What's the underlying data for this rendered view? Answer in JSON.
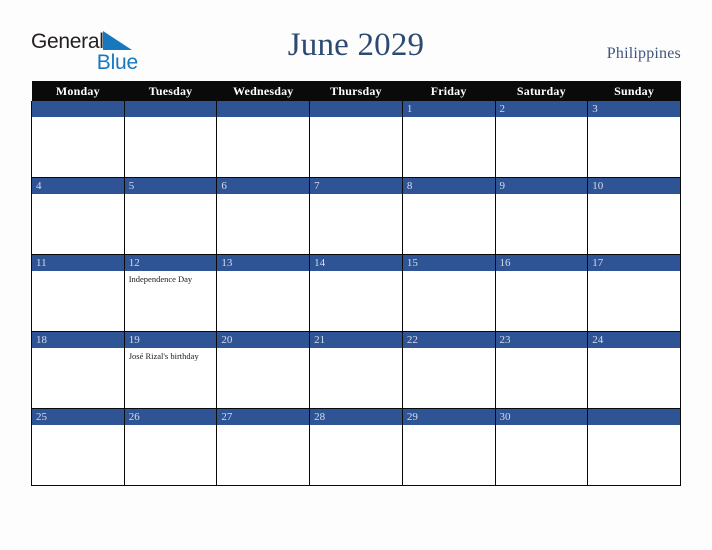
{
  "brand": {
    "name_part1": "General",
    "name_part2": "Blue",
    "triangle_icon": "blue-triangle-icon",
    "color_dark": "#231f20",
    "color_blue": "#1878be"
  },
  "header": {
    "title": "June 2029",
    "country": "Philippines",
    "title_color": "#2e4a72"
  },
  "calendar": {
    "month": "June",
    "year": "2029",
    "weekday_headers": [
      "Monday",
      "Tuesday",
      "Wednesday",
      "Thursday",
      "Friday",
      "Saturday",
      "Sunday"
    ],
    "header_bg": "#0a0a0a",
    "daybar_bg": "#2e5496",
    "daybar_text": "#d6dce8",
    "weeks": [
      [
        {
          "day": ""
        },
        {
          "day": ""
        },
        {
          "day": ""
        },
        {
          "day": ""
        },
        {
          "day": "1"
        },
        {
          "day": "2"
        },
        {
          "day": "3"
        }
      ],
      [
        {
          "day": "4"
        },
        {
          "day": "5"
        },
        {
          "day": "6"
        },
        {
          "day": "7"
        },
        {
          "day": "8"
        },
        {
          "day": "9"
        },
        {
          "day": "10"
        }
      ],
      [
        {
          "day": "11"
        },
        {
          "day": "12",
          "events": [
            "Independence Day"
          ]
        },
        {
          "day": "13"
        },
        {
          "day": "14"
        },
        {
          "day": "15"
        },
        {
          "day": "16"
        },
        {
          "day": "17"
        }
      ],
      [
        {
          "day": "18"
        },
        {
          "day": "19",
          "events": [
            "José Rizal's birthday"
          ]
        },
        {
          "day": "20"
        },
        {
          "day": "21"
        },
        {
          "day": "22"
        },
        {
          "day": "23"
        },
        {
          "day": "24"
        }
      ],
      [
        {
          "day": "25"
        },
        {
          "day": "26"
        },
        {
          "day": "27"
        },
        {
          "day": "28"
        },
        {
          "day": "29"
        },
        {
          "day": "30"
        },
        {
          "day": ""
        }
      ]
    ]
  }
}
